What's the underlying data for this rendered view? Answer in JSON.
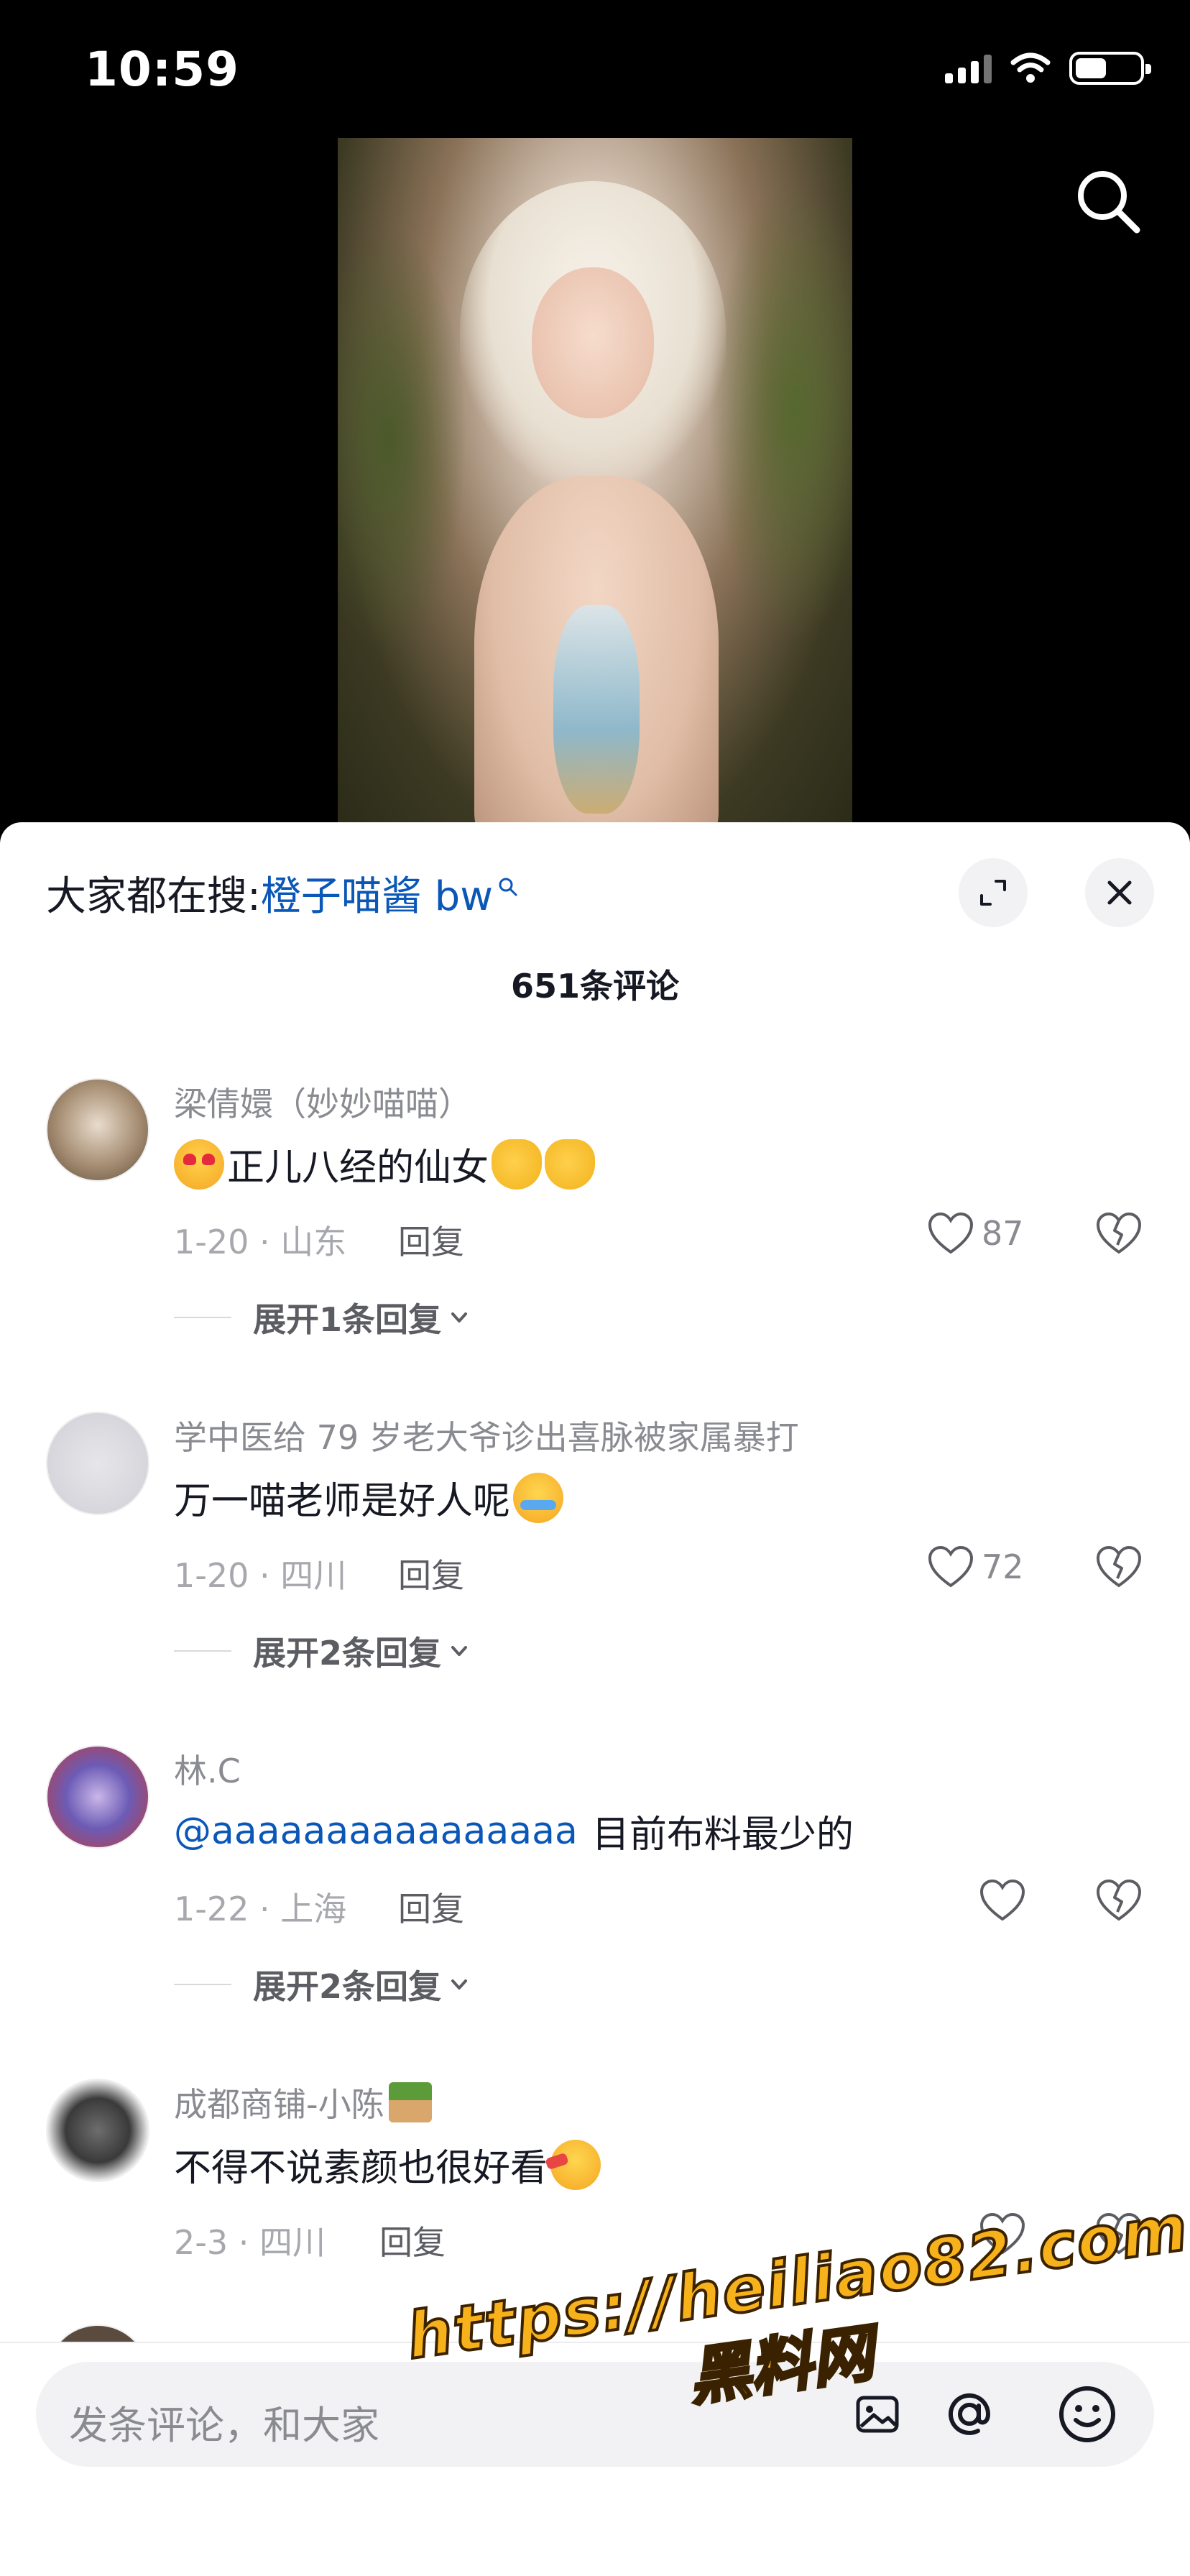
{
  "status_bar": {
    "time": "10:59"
  },
  "search_suggestion": {
    "prefix": "大家都在搜:",
    "keyword": "橙子喵酱 bw"
  },
  "comment_count": "651条评论",
  "comments": [
    {
      "name": "梁倩嬛（妙妙喵喵）",
      "text": "正儿八经的仙女",
      "meta": "1-20 · 山东",
      "reply": "回复",
      "likes": "87",
      "expand": "展开1条回复"
    },
    {
      "name": "学中医给 79 岁老大爷诊出喜脉被家属暴打",
      "text": "万一喵老师是好人呢",
      "meta": "1-20 · 四川",
      "reply": "回复",
      "likes": "72",
      "expand": "展开2条回复"
    },
    {
      "name": "林.C",
      "mention": "@aaaaaaaaaaaaaaaa",
      "text": "目前布料最少的",
      "meta": "1-22 · 上海",
      "reply": "回复",
      "likes": "",
      "expand": "展开2条回复"
    },
    {
      "name": "成都商铺-小陈",
      "text": "不得不说素颜也很好看",
      "meta": "2-3 · 四川",
      "reply": "回复",
      "likes": ""
    }
  ],
  "input": {
    "placeholder": "发条评论，和大家"
  },
  "watermark": {
    "url": "https://heiliao82.com",
    "text": "黑料网"
  },
  "colors": {
    "accent_link": "#0a57b8",
    "sheet_bg": "#ffffff",
    "watermark": "#f7b21b"
  },
  "icons": [
    "search-icon",
    "expand-icon",
    "close-icon",
    "heart-icon",
    "broken-heart-icon",
    "chevron-down-icon",
    "at-icon",
    "emoji-icon"
  ]
}
